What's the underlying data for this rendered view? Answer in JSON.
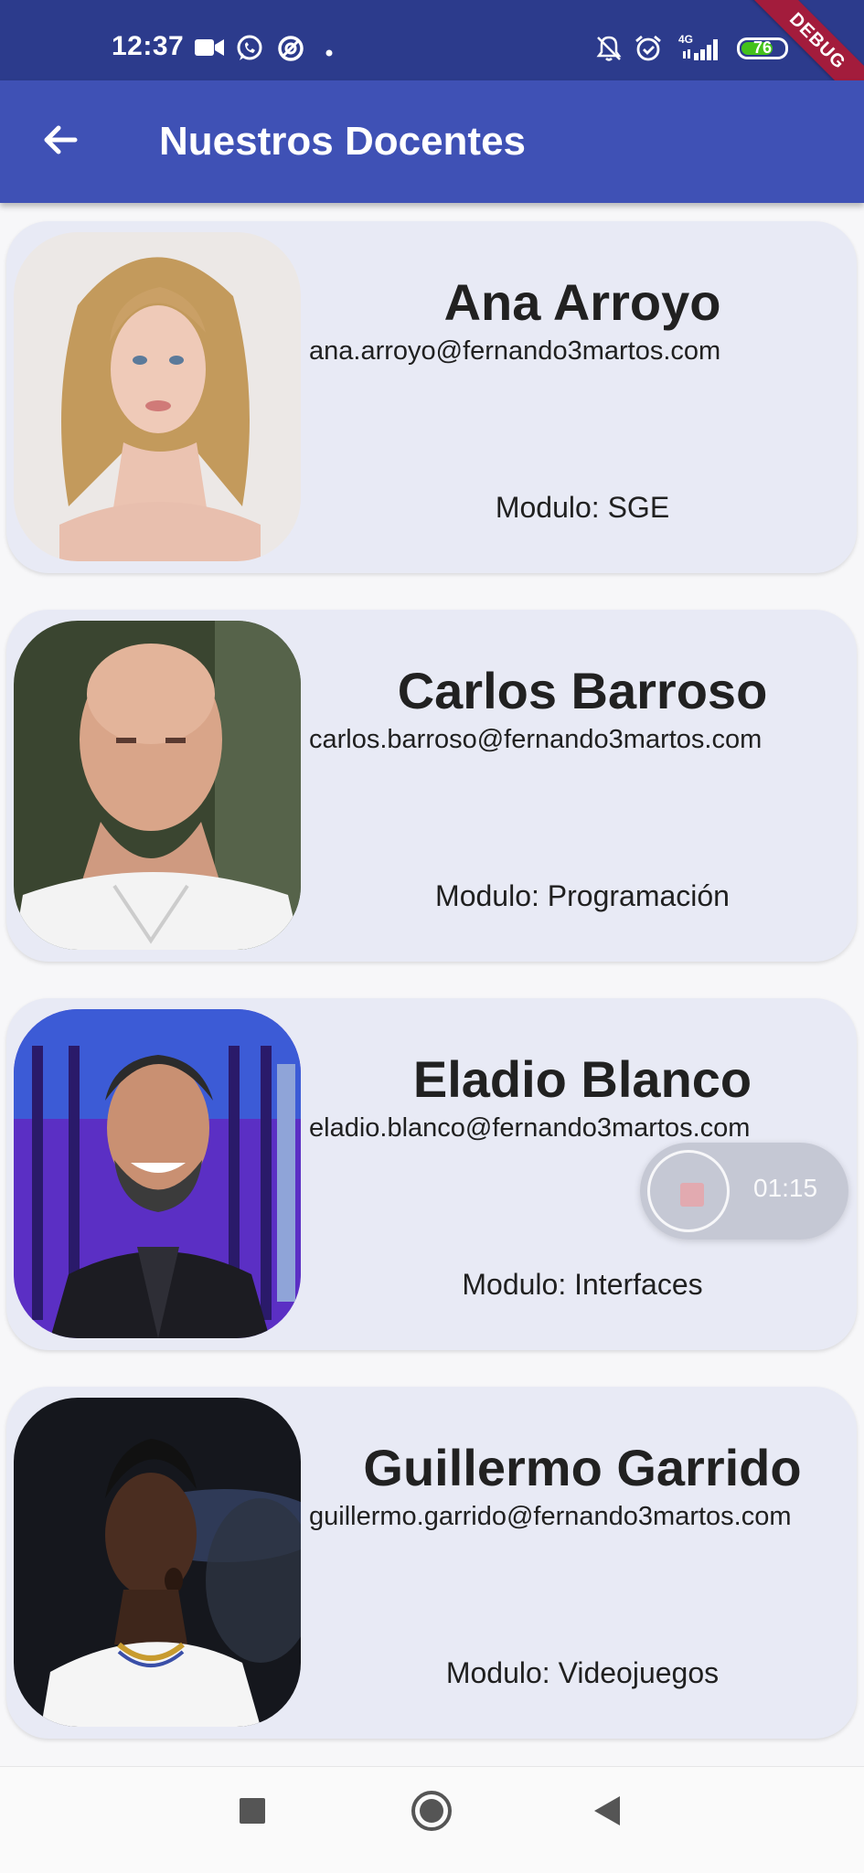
{
  "status_bar": {
    "time": "12:37",
    "network": "4G",
    "battery": "76",
    "battery_level_percent": 76
  },
  "debug_banner": "DEBUG",
  "app_bar": {
    "title": "Nuestros Docentes",
    "back_icon": "arrow-back-icon"
  },
  "teachers": [
    {
      "name": "Ana Arroyo",
      "email": "ana.arroyo@fernando3martos.com",
      "module": "Modulo: SGE"
    },
    {
      "name": "Carlos Barroso",
      "email": "carlos.barroso@fernando3martos.com",
      "module": "Modulo: Programación"
    },
    {
      "name": "Eladio Blanco",
      "email": "eladio.blanco@fernando3martos.com",
      "module": "Modulo: Interfaces"
    },
    {
      "name": "Guillermo Garrido",
      "email": "guillermo.garrido@fernando3martos.com",
      "module": "Modulo: Videojuegos"
    }
  ],
  "recorder": {
    "time": "01:15",
    "icon": "stop-icon"
  },
  "nav_bar": {
    "icons": [
      "recents-square-icon",
      "home-circle-icon",
      "back-triangle-icon"
    ]
  },
  "colors": {
    "status_bar": "#2c3b8c",
    "app_bar": "#3f51b5",
    "card": "#e8eaf5",
    "debug": "#a31c3c"
  }
}
